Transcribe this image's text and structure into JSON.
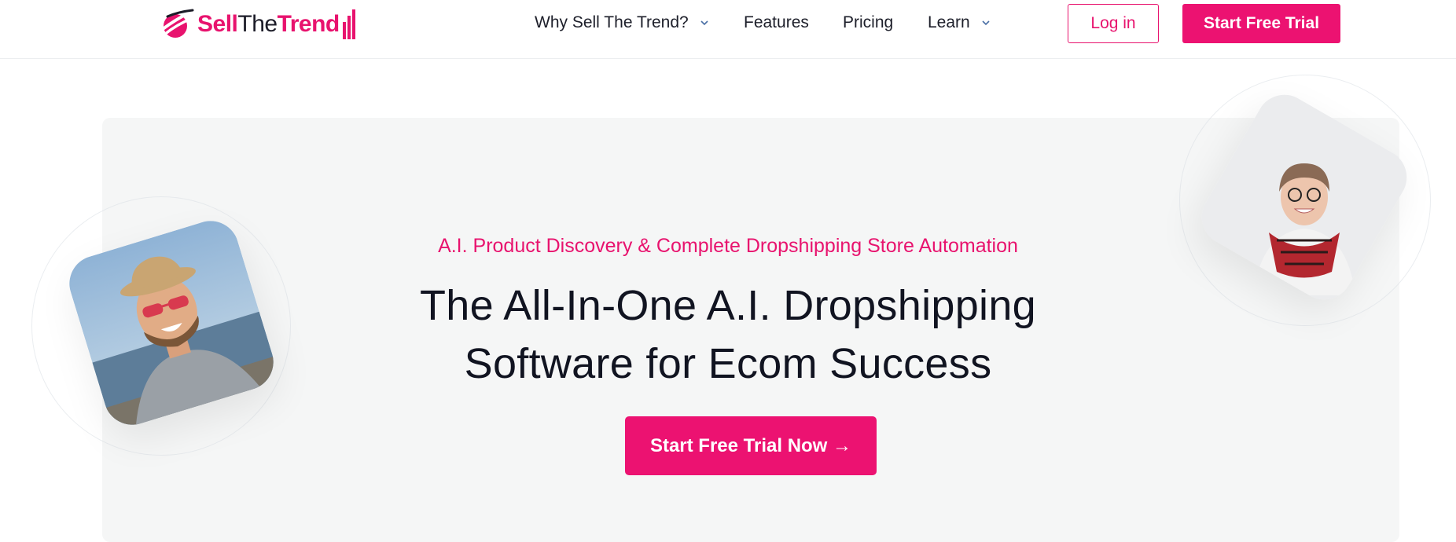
{
  "header": {
    "logo": {
      "sell": "Sell",
      "the": "The",
      "trend": "Trend"
    },
    "nav": [
      {
        "label": "Why Sell The Trend?",
        "has_dropdown": true
      },
      {
        "label": "Features",
        "has_dropdown": false
      },
      {
        "label": "Pricing",
        "has_dropdown": false
      },
      {
        "label": "Learn",
        "has_dropdown": true
      }
    ],
    "login_label": "Log in",
    "trial_label": "Start Free Trial"
  },
  "hero": {
    "subtitle": "A.I. Product Discovery & Complete Dropshipping Store Automation",
    "title_line1": "The All-In-One A.I. Dropshipping",
    "title_line2": "Software for Ecom Success",
    "cta_label": "Start Free Trial Now →"
  },
  "colors": {
    "brand_pink": "#e8136e",
    "hero_bg": "#f5f6f6",
    "text_dark": "#111421"
  },
  "icons": {
    "logo_mark": "swoosh-logo-icon",
    "dropdown": "chevron-down-icon"
  }
}
